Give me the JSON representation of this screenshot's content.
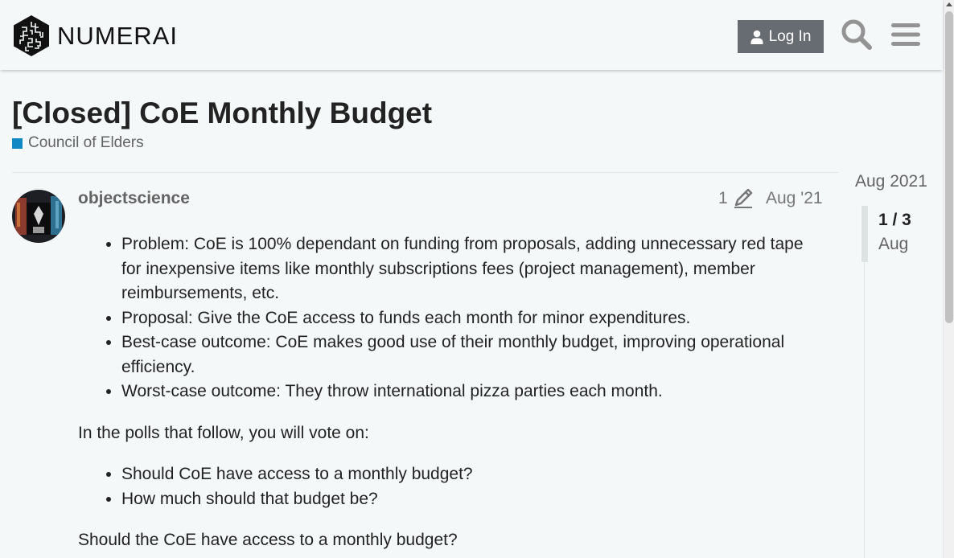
{
  "header": {
    "logo_text": "NUMERAI",
    "login_label": "Log In",
    "search_icon": "search-icon",
    "menu_icon": "hamburger-menu-icon"
  },
  "topic": {
    "title": "[Closed] CoE Monthly Budget",
    "category": "Council of Elders",
    "category_color": "#0e88c4"
  },
  "post": {
    "username": "objectscience",
    "edit_count": "1",
    "date": "Aug '21",
    "list1": [
      "Problem: CoE is 100% dependant on funding from proposals, adding unnecessary red tape for inexpensive items like monthly subscriptions fees (project management), member reimbursements, etc.",
      "Proposal: Give the CoE access to funds each month for minor expenditures.",
      "Best-case outcome: CoE makes good use of their monthly budget, improving operational efficiency.",
      "Worst-case outcome: They throw international pizza parties each month."
    ],
    "paragraph1": "In the polls that follow, you will vote on:",
    "list2": [
      "Should CoE have access to a monthly budget?",
      "How much should that budget be?"
    ],
    "paragraph2": "Should the CoE have access to a monthly budget?"
  },
  "timeline": {
    "start_date": "Aug 2021",
    "position": "1 / 3",
    "current_date": "Aug"
  }
}
